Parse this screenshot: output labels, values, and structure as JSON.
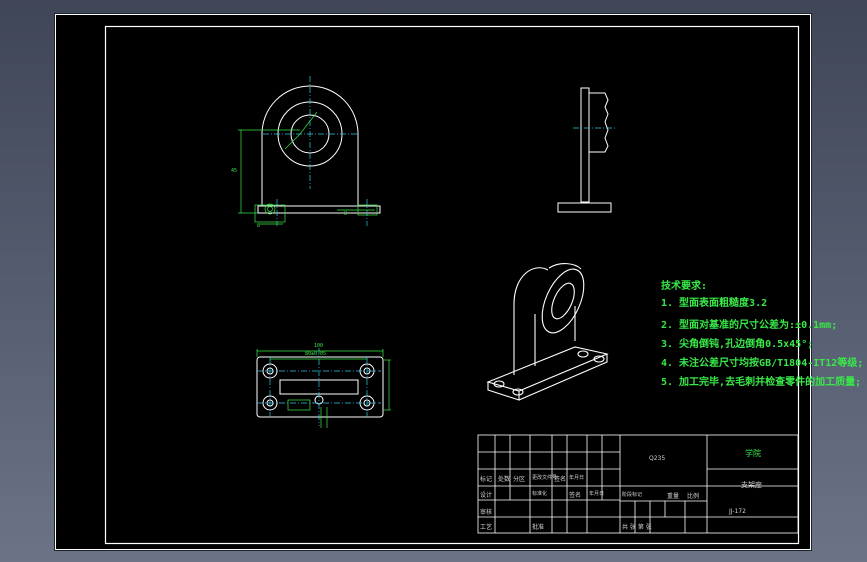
{
  "tech_requirements": {
    "heading": "技术要求:",
    "items": [
      "1. 型面表面粗糙度3.2",
      "2. 型面对基准的尺寸公差为:±0.1mm;",
      "3. 尖角倒钝,孔边倒角0.5x45°;",
      "4. 未注公差尺寸均按GB/T1804-IT12等级;",
      "5. 加工完毕,去毛刺并检查零件的加工质量;"
    ]
  },
  "title_block": {
    "material": "Q235",
    "school": "学院",
    "part_name": "支架座",
    "drawing_no": "JJ-172",
    "row_labels": [
      "标记",
      "设计",
      "审核",
      "工艺"
    ],
    "cells": [
      "处数",
      "分区",
      "更改文件号",
      "签名",
      "年月日",
      "标准化",
      "签名",
      "年月日",
      "批准"
    ],
    "stage_labels": [
      "阶段标记",
      "重量",
      "比例"
    ],
    "sheet": "共 张 第 张"
  },
  "dimensions": {
    "front_left_base": "8",
    "front_right_base": "8",
    "front_height": "45",
    "top_overall": "100",
    "top_hole_spacing": "80±0.05"
  },
  "colors": {
    "background": "#000000",
    "outline": "#ffffff",
    "dimension": "#38e848",
    "centerline": "#2ec8e8"
  }
}
